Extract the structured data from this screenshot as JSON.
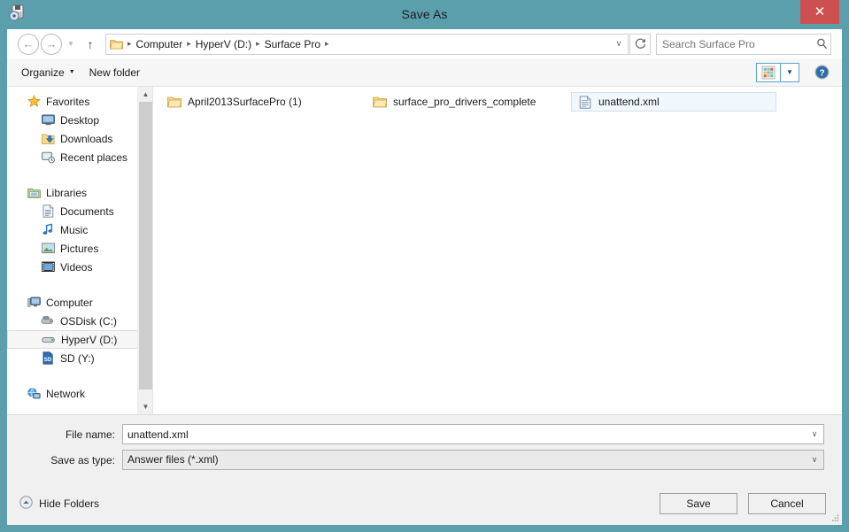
{
  "window": {
    "title": "Save As",
    "icon": "save-as-icon",
    "close_label": "✕",
    "titlebar_color": "#5b9fad",
    "close_color": "#cd5050"
  },
  "nav": {
    "back_icon": "←",
    "forward_icon": "→",
    "recent_icon": "▼",
    "up_icon": "↑",
    "dropdown_icon": "∨",
    "refresh_icon": "↻",
    "breadcrumb_folder_icon": "folder-icon",
    "separator": "▸",
    "breadcrumbs": [
      "Computer",
      "HyperV (D:)",
      "Surface Pro"
    ]
  },
  "search": {
    "placeholder": "Search Surface Pro",
    "value": "",
    "icon": "search-icon"
  },
  "toolbar": {
    "organize_label": "Organize",
    "organize_caret": "▼",
    "new_folder_label": "New folder",
    "view_icon": "tiles-view-icon",
    "view_caret": "▼",
    "help_icon": "help-icon"
  },
  "sidebar": {
    "scroll_up_icon": "▲",
    "scroll_down_icon": "▼",
    "groups": [
      {
        "header": {
          "label": "Favorites",
          "icon": "star-icon"
        },
        "items": [
          {
            "label": "Desktop",
            "icon": "desktop-icon",
            "selected": false
          },
          {
            "label": "Downloads",
            "icon": "downloads-icon",
            "selected": false
          },
          {
            "label": "Recent places",
            "icon": "recent-places-icon",
            "selected": false
          }
        ]
      },
      {
        "header": {
          "label": "Libraries",
          "icon": "libraries-icon"
        },
        "items": [
          {
            "label": "Documents",
            "icon": "documents-icon",
            "selected": false
          },
          {
            "label": "Music",
            "icon": "music-icon",
            "selected": false
          },
          {
            "label": "Pictures",
            "icon": "pictures-icon",
            "selected": false
          },
          {
            "label": "Videos",
            "icon": "videos-icon",
            "selected": false
          }
        ]
      },
      {
        "header": {
          "label": "Computer",
          "icon": "computer-icon"
        },
        "items": [
          {
            "label": "OSDisk (C:)",
            "icon": "harddisk-icon",
            "selected": false
          },
          {
            "label": "HyperV (D:)",
            "icon": "drive-icon",
            "selected": true
          },
          {
            "label": "SD (Y:)",
            "icon": "sd-card-icon",
            "selected": false
          }
        ]
      },
      {
        "header": {
          "label": "Network",
          "icon": "network-icon"
        },
        "items": []
      }
    ]
  },
  "filelist": {
    "items": [
      {
        "name": "April2013SurfacePro (1)",
        "icon": "folder-icon",
        "selected": false
      },
      {
        "name": "surface_pro_drivers_complete",
        "icon": "folder-icon",
        "selected": false
      },
      {
        "name": "unattend.xml",
        "icon": "xml-file-icon",
        "selected": true
      }
    ]
  },
  "form": {
    "filename_label": "File name:",
    "filename_value": "unattend.xml",
    "filetype_label": "Save as type:",
    "filetype_value": "Answer files (*.xml)",
    "dropdown_icon": "∨"
  },
  "footer": {
    "hide_folders_label": "Hide Folders",
    "hide_folders_icon": "chevron-up-circle-icon",
    "save_label": "Save",
    "cancel_label": "Cancel"
  }
}
